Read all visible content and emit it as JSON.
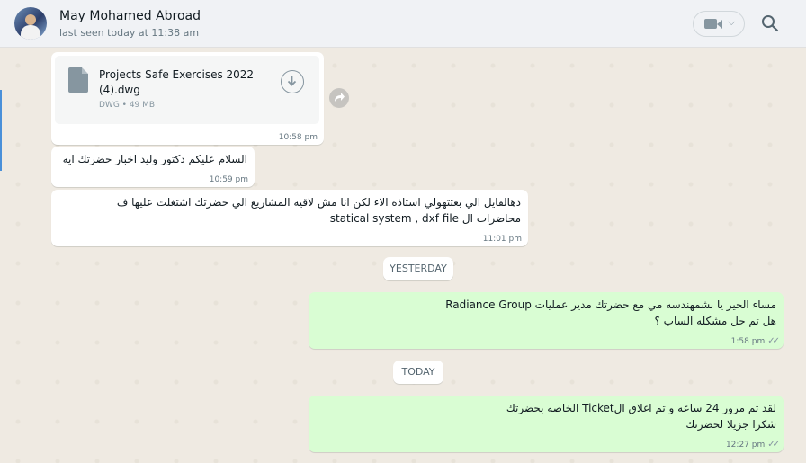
{
  "header": {
    "contact_name": "May Mohamed Abroad",
    "contact_status": "last seen today at 11:38 am",
    "icons": [
      "video-call-icon",
      "chevron-down-icon",
      "search-icon"
    ]
  },
  "messages": {
    "m1": {
      "file_name": "Projects Safe Exercises 2022 (4).dwg",
      "file_meta": "DWG • 49 MB",
      "time": "10:58 pm"
    },
    "m2": {
      "text": "السلام عليكم دكتور وليد اخبار حضرتك ايه",
      "time": "10:59 pm"
    },
    "m3": {
      "line1": "دهالفايل الي بعتتهولي استاذه الاء لكن انا مش لاقيه المشاريع الي حضرتك اشتغلت عليها ف",
      "line2": "محاضرات ال statical system , dxf file",
      "time": "11:01 pm"
    },
    "m4": {
      "line1": "مساء الخير يا بشمهندسه مي مع حضرتك مدير عمليات Radiance Group",
      "line2": "هل تم حل مشكله الساب ؟",
      "time": "1:58 pm"
    },
    "m5": {
      "line1": "لقد تم مرور 24 ساعه و تم اغلاق الTicket الخاصه بحضرتك",
      "line2": "شكرا جزيلا لحضرتك",
      "time": "12:27 pm"
    }
  },
  "dividers": {
    "yesterday": "YESTERDAY",
    "today": "TODAY"
  },
  "colors": {
    "incoming": "#ffffff",
    "outgoing": "#d9fdd3",
    "background": "#efeae2",
    "header": "#f0f2f5"
  }
}
